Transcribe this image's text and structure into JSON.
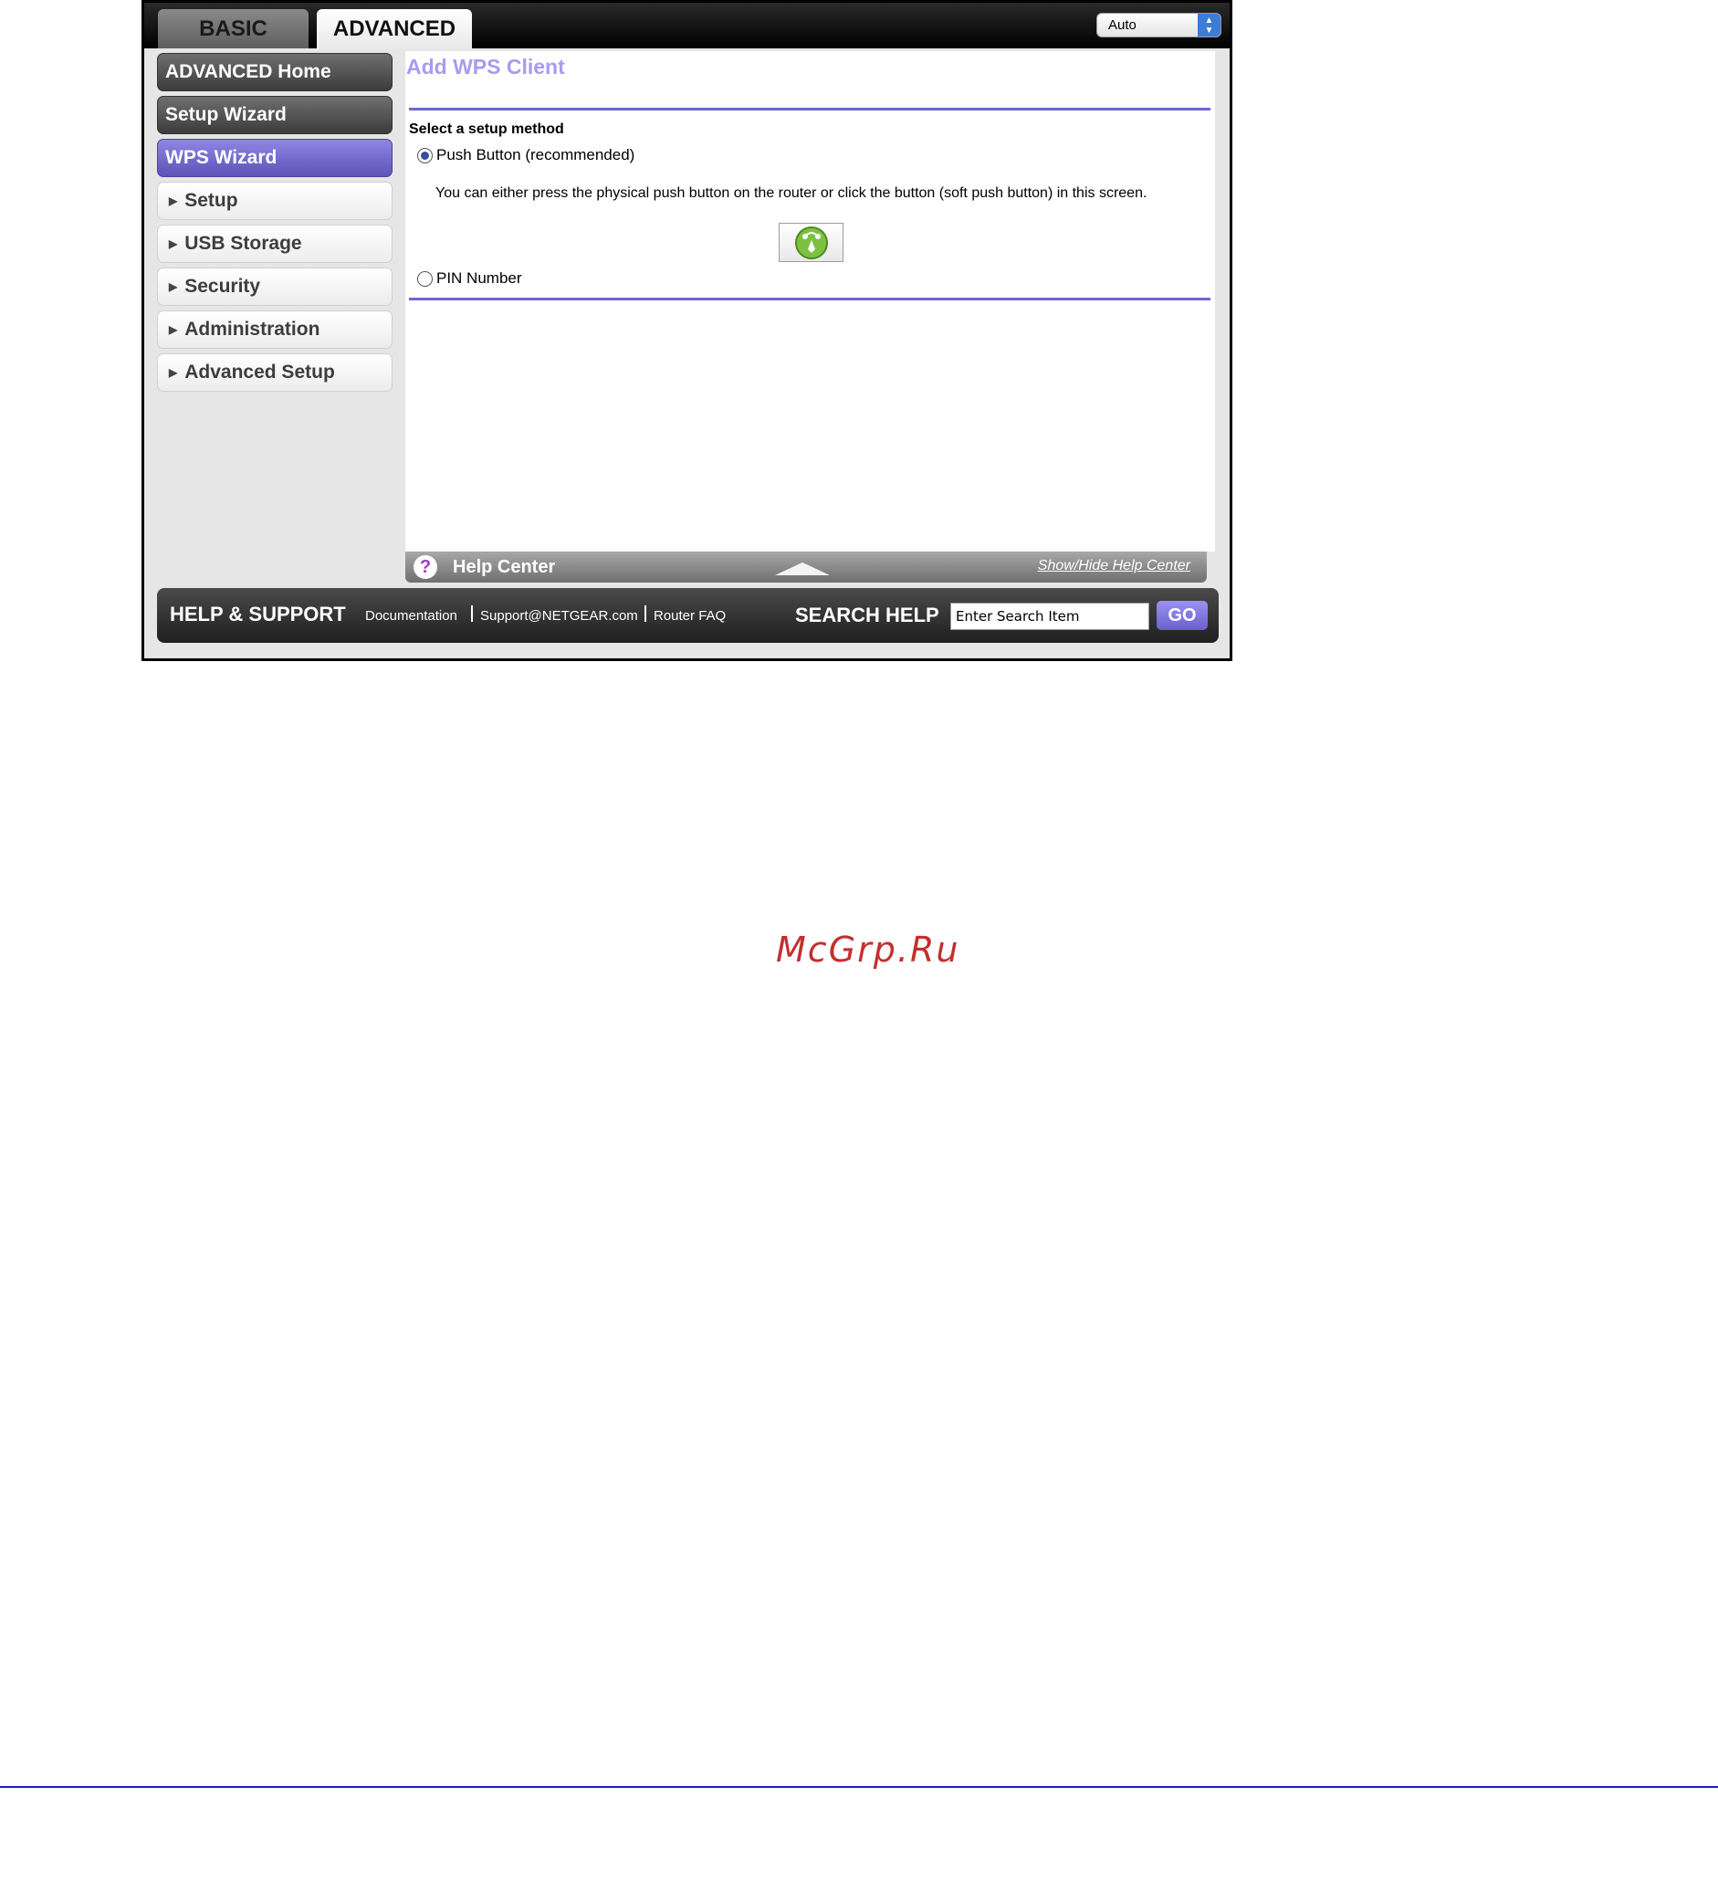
{
  "tabs": {
    "basic": "BASIC",
    "advanced": "ADVANCED"
  },
  "language_select": {
    "value": "Auto"
  },
  "sidebar": {
    "items": [
      {
        "label": "ADVANCED Home",
        "style": "dark"
      },
      {
        "label": "Setup Wizard",
        "style": "dark"
      },
      {
        "label": "WPS Wizard",
        "style": "active"
      },
      {
        "label": "Setup",
        "style": "expandable"
      },
      {
        "label": "USB Storage",
        "style": "expandable"
      },
      {
        "label": "Security",
        "style": "expandable"
      },
      {
        "label": "Administration",
        "style": "expandable"
      },
      {
        "label": "Advanced Setup",
        "style": "expandable"
      }
    ]
  },
  "main": {
    "title": "Add WPS Client",
    "setup_method_label": "Select a setup method",
    "push_button_option": "Push Button (recommended)",
    "push_button_selected": true,
    "push_button_description": "You can either press the physical push button on the router or click the button (soft push button) in this screen.",
    "pin_option": "PIN Number",
    "pin_selected": false
  },
  "help_center": {
    "icon": "?",
    "label": "Help Center",
    "toggle": "Show/Hide Help Center"
  },
  "support": {
    "title": "HELP & SUPPORT",
    "links": [
      "Documentation",
      "Support@NETGEAR.com",
      "Router FAQ"
    ],
    "search_title": "SEARCH HELP",
    "search_placeholder": "Enter Search Item",
    "go_label": "GO"
  },
  "watermark": "McGrp.Ru",
  "colors": {
    "accent": "#6f66d2",
    "title": "#a69cf0",
    "watermark": "#c42f2f",
    "page_rule": "#1c1cc8"
  }
}
